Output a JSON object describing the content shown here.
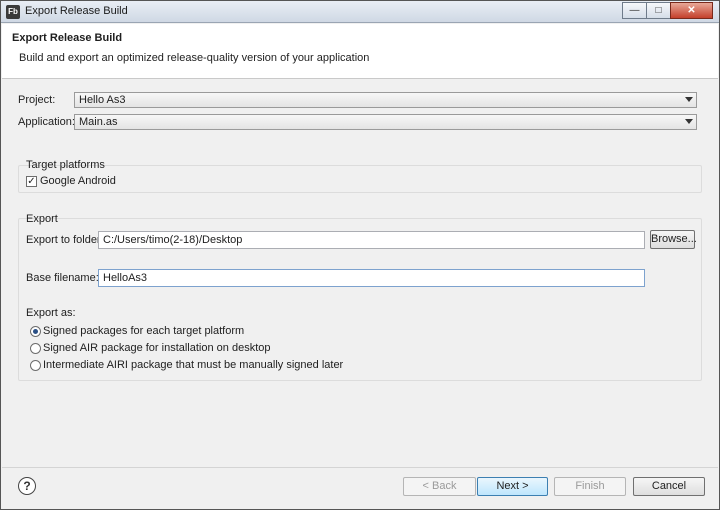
{
  "window": {
    "title": "Export Release Build",
    "app_icon_text": "Fb",
    "minimize_glyph": "—",
    "maximize_glyph": "□",
    "close_glyph": "✕"
  },
  "banner": {
    "title": "Export Release Build",
    "description": "Build and export an optimized release-quality version of your application"
  },
  "project": {
    "label": "Project:",
    "value": "Hello As3"
  },
  "application": {
    "label": "Application:",
    "value": "Main.as"
  },
  "target_platforms": {
    "heading": "Target platforms",
    "items": [
      {
        "label": "Google Android",
        "checked": true,
        "mark": "✓"
      }
    ]
  },
  "export": {
    "heading": "Export",
    "folder_label": "Export to folder:",
    "folder_value": "C:/Users/timo(2-18)/Desktop",
    "browse_label": "Browse...",
    "basename_label": "Base filename:",
    "basename_value": "HelloAs3",
    "export_as_label": "Export as:",
    "options": [
      {
        "label": "Signed packages for each target platform",
        "selected": true
      },
      {
        "label": "Signed AIR package for installation on desktop",
        "selected": false
      },
      {
        "label": "Intermediate AIRI package that must be manually signed later",
        "selected": false
      }
    ]
  },
  "footer": {
    "help_glyph": "?",
    "back_label": "< Back",
    "next_label": "Next >",
    "finish_label": "Finish",
    "cancel_label": "Cancel"
  }
}
